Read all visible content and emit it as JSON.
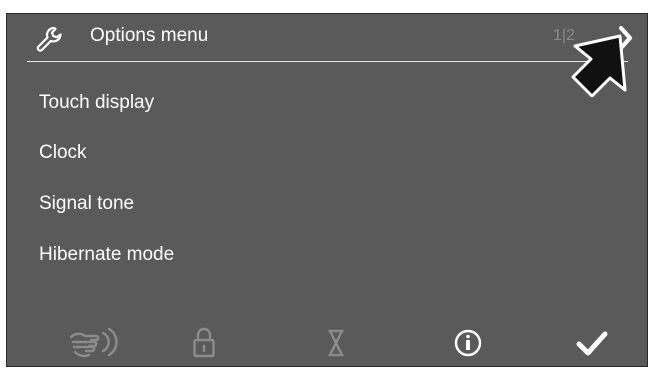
{
  "header": {
    "title": "Options menu",
    "page_indicator": "1|2",
    "icon": "wrench-icon",
    "next_icon": "chevron-right-icon"
  },
  "menu": {
    "items": [
      {
        "label": "Touch display"
      },
      {
        "label": "Clock"
      },
      {
        "label": "Signal tone"
      },
      {
        "label": "Hibernate mode"
      }
    ]
  },
  "bottom_bar": {
    "icons": [
      "hand-wipe-icon",
      "lock-icon",
      "hourglass-icon",
      "info-icon",
      "checkmark-icon"
    ]
  },
  "colors": {
    "screen_bg": "#5a5a5a",
    "text": "#ffffff",
    "muted": "#8a8a8a",
    "icon_muted": "#8c8c8c"
  }
}
